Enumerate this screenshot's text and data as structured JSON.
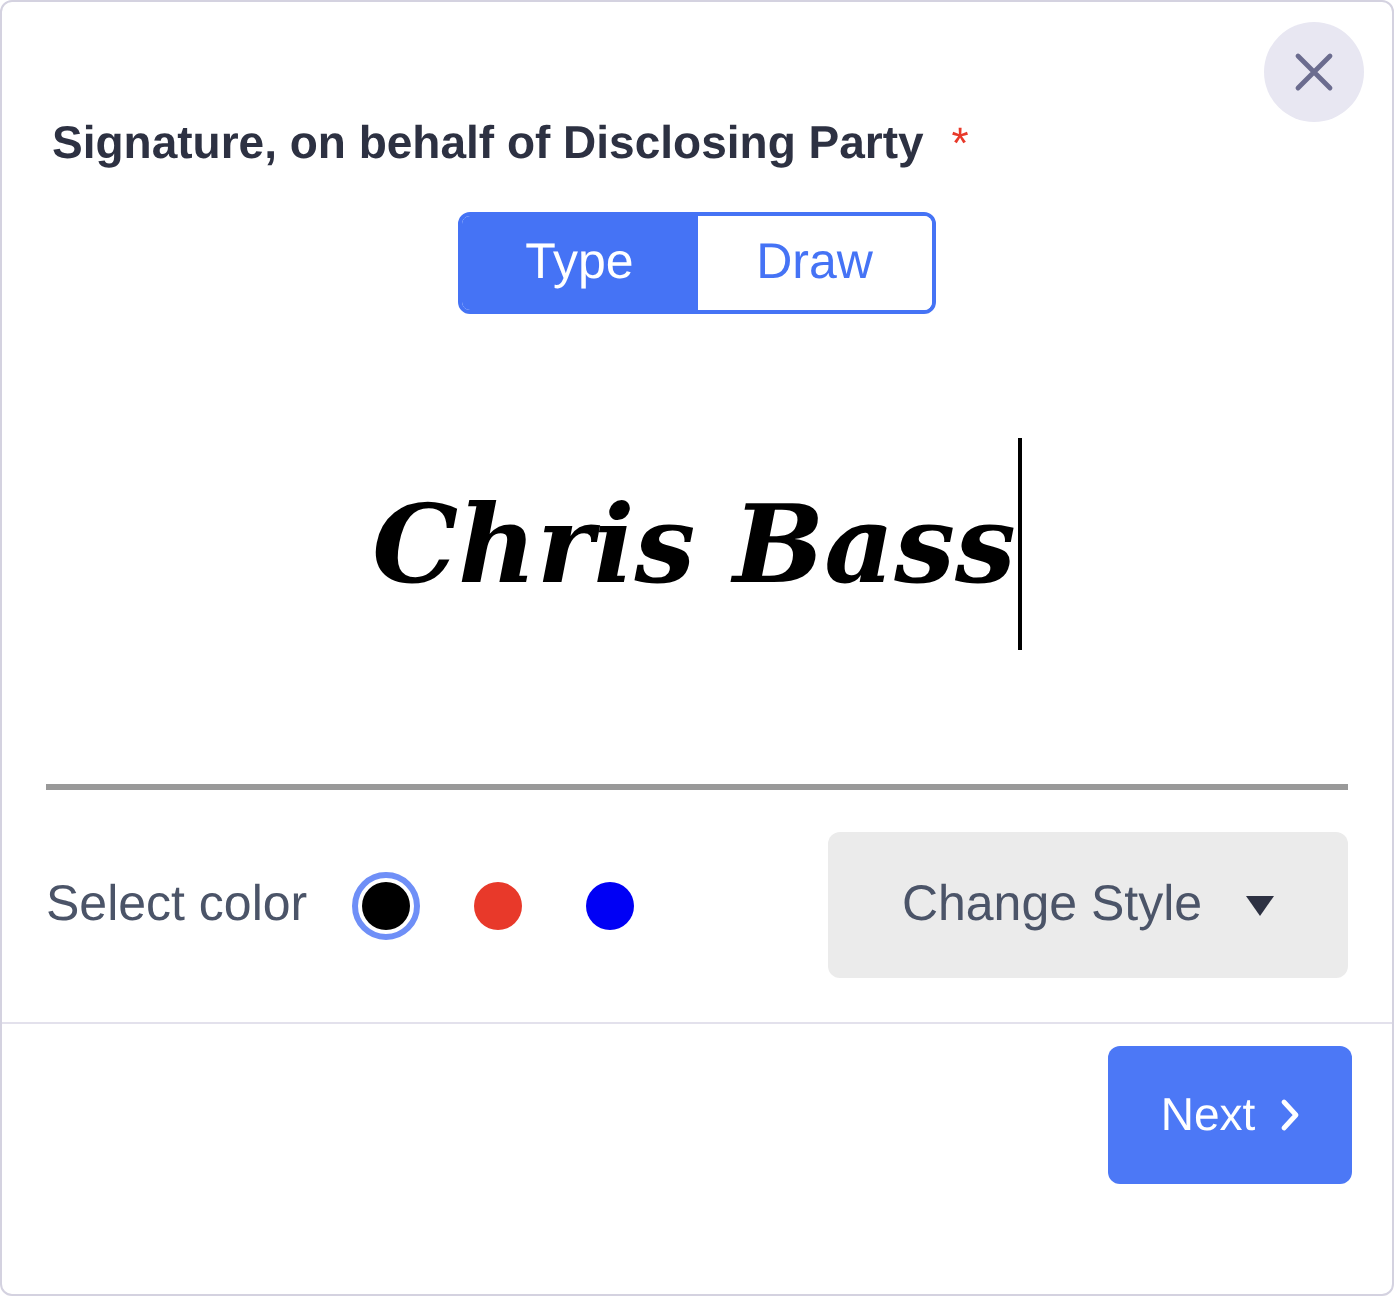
{
  "dialog": {
    "title": "Signature, on behalf of Disclosing Party",
    "required_mark": "*"
  },
  "tabs": [
    {
      "label": "Type",
      "selected": true
    },
    {
      "label": "Draw",
      "selected": false
    }
  ],
  "signature": {
    "value": "Chris Bass",
    "focused": true
  },
  "color_picker": {
    "label": "Select color",
    "swatches": [
      {
        "color": "#000000",
        "selected": true
      },
      {
        "color": "#e8392a",
        "selected": false
      },
      {
        "color": "#0000f5",
        "selected": false
      }
    ]
  },
  "style_button": {
    "label": "Change Style"
  },
  "next_button": {
    "label": "Next"
  }
}
